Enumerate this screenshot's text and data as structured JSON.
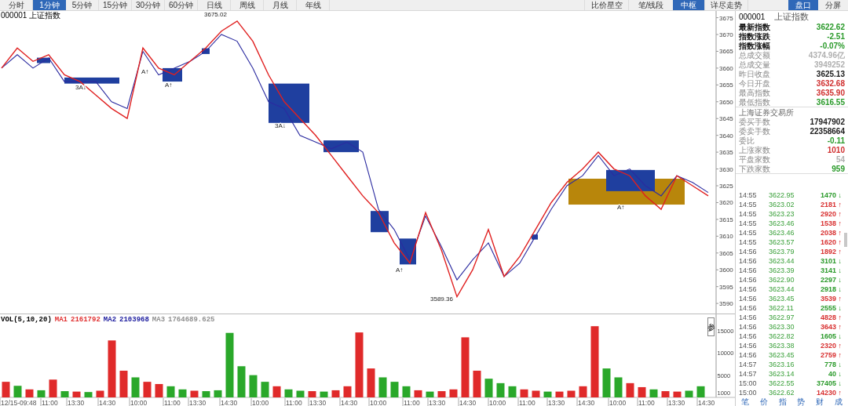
{
  "toolbar": {
    "periods": [
      {
        "label": "分时",
        "selected": false
      },
      {
        "label": "1分钟",
        "selected": true
      },
      {
        "label": "5分钟",
        "selected": false
      },
      {
        "label": "15分钟",
        "selected": false
      },
      {
        "label": "30分钟",
        "selected": false
      },
      {
        "label": "60分钟",
        "selected": false
      },
      {
        "label": "日线",
        "selected": false
      },
      {
        "label": "周线",
        "selected": false
      },
      {
        "label": "月线",
        "selected": false
      },
      {
        "label": "年线",
        "selected": false
      }
    ],
    "tools": [
      {
        "label": "比价星空",
        "selected": false
      },
      {
        "label": "笔/线段",
        "selected": false
      },
      {
        "label": "中枢",
        "selected": true
      },
      {
        "label": "详尽走势",
        "selected": false
      }
    ],
    "views": [
      {
        "label": "盘口",
        "selected": true
      },
      {
        "label": "分屏",
        "selected": false
      }
    ]
  },
  "price_chart": {
    "title": "000001 上证指数",
    "zones": [
      {
        "color": "#b8860b"
      },
      {
        "color": "#1f3f9f"
      },
      {
        "color": "#1f3f9f"
      },
      {
        "color": "#1f3f9f"
      },
      {
        "color": "#1f3f9f"
      },
      {
        "color": "#1f3f9f"
      },
      {
        "color": "#1f3f9f"
      },
      {
        "color": "#1f3f9f"
      },
      {
        "color": "#1f3f9f"
      },
      {
        "color": "#1f3f9f"
      },
      {
        "color": "#1f3f9f"
      }
    ],
    "chart_data": {
      "type": "line",
      "ylim": [
        3587,
        3677
      ],
      "yticks": [
        3590,
        3595,
        3600,
        3605,
        3610,
        3615,
        3620,
        3625,
        3630,
        3635,
        3640,
        3645,
        3650,
        3655,
        3660,
        3665,
        3670,
        3675
      ],
      "series": [
        {
          "color": "#2b2ba0",
          "values": [
            3660,
            3664,
            3660,
            3663,
            3656,
            3656,
            3656,
            3650,
            3648,
            3665,
            3658,
            3660,
            3662,
            3665,
            3670,
            3668,
            3660,
            3650,
            3648,
            3640,
            3638,
            3636,
            3638,
            3635,
            3618,
            3612,
            3603,
            3616,
            3607,
            3597,
            3603,
            3608,
            3598,
            3602,
            3610,
            3618,
            3625,
            3628,
            3634,
            3628,
            3630,
            3625,
            3622,
            3628,
            3626,
            3623
          ]
        },
        {
          "color": "#e02020",
          "values": [
            3660,
            3666,
            3662,
            3664,
            3658,
            3656,
            3652,
            3648,
            3645,
            3666,
            3660,
            3658,
            3662,
            3666,
            3671,
            3674,
            3668,
            3658,
            3650,
            3645,
            3640,
            3634,
            3628,
            3622,
            3617,
            3608,
            3602,
            3617,
            3606,
            3592,
            3600,
            3612,
            3598,
            3604,
            3612,
            3620,
            3626,
            3630,
            3635,
            3630,
            3628,
            3622,
            3618,
            3628,
            3625,
            3622
          ]
        }
      ],
      "annotations": [
        "3675.02",
        "3589.36",
        "3A↓",
        "A↑",
        "A↑",
        "3A↓",
        "A↑",
        "A↑"
      ]
    }
  },
  "volume_chart": {
    "legend": [
      {
        "text": "VOL(5,10,20)",
        "color": "#000000"
      },
      {
        "text": "MA1",
        "color": "#e03030"
      },
      {
        "text": "2161792",
        "color": "#e03030"
      },
      {
        "text": "MA2",
        "color": "#2020a0"
      },
      {
        "text": "2103968",
        "color": "#2020a0"
      },
      {
        "text": "MA3",
        "color": "#909090"
      },
      {
        "text": "1764689.625",
        "color": "#909090"
      }
    ],
    "param_label": "参",
    "chart_data": {
      "type": "bar",
      "stacked": true,
      "ylim": [
        0,
        18500
      ],
      "yticks": [
        1000,
        5000,
        10000,
        15000
      ],
      "series": [
        {
          "color": "#e02a2a",
          "values": [
            3500,
            0,
            1800,
            0,
            4000,
            0,
            1300,
            0,
            1500,
            12800,
            6000,
            0,
            3500,
            3000,
            0,
            0,
            1500,
            0,
            0,
            0,
            0,
            0,
            0,
            2500,
            0,
            0,
            1400,
            0,
            1600,
            2500,
            14600,
            6500,
            0,
            0,
            0,
            1600,
            0,
            1400,
            1800,
            13500,
            6000,
            0,
            0,
            0,
            1800,
            1500,
            0,
            1300,
            1500,
            2500,
            16000,
            0,
            0,
            3200,
            2300,
            0,
            1400,
            1300,
            0,
            0
          ]
        },
        {
          "color": "#2aa82a",
          "values": [
            0,
            2600,
            0,
            1600,
            0,
            1400,
            0,
            1200,
            0,
            0,
            0,
            4500,
            0,
            0,
            2500,
            1800,
            0,
            1400,
            1600,
            14500,
            7000,
            5000,
            3500,
            0,
            1800,
            1500,
            0,
            1300,
            0,
            0,
            0,
            0,
            4500,
            3500,
            2500,
            0,
            1300,
            0,
            0,
            0,
            0,
            4200,
            3200,
            2500,
            0,
            0,
            1300,
            0,
            0,
            0,
            0,
            6500,
            4500,
            0,
            0,
            1800,
            0,
            0,
            1500,
            2500
          ]
        }
      ]
    }
  },
  "time_axis": [
    "12/15-09:48",
    "11:00",
    "13:30",
    "14:30",
    "10:00",
    "11:00",
    "13:30",
    "14:30",
    "10:00",
    "11:00",
    "13:30",
    "14:30",
    "10:00",
    "11:00",
    "13:30",
    "14:30",
    "10:00",
    "11:00",
    "13:30",
    "14:30",
    "10:00",
    "11:00",
    "13:30",
    "14:30"
  ],
  "quote": {
    "code": "000001",
    "name": "上证指数",
    "rows": [
      {
        "label": "最新指数",
        "value": "3622.62",
        "color": "#2a9a2a",
        "strong": true
      },
      {
        "label": "指数涨跌",
        "value": "-2.51",
        "color": "#2a9a2a",
        "strong": true
      },
      {
        "label": "指数涨幅",
        "value": "-0.07%",
        "color": "#2a9a2a",
        "strong": true
      },
      {
        "label": "总成交额",
        "value": "4374.96亿",
        "color": "#b0b0b0",
        "strong": false
      },
      {
        "label": "总成交量",
        "value": "3949252",
        "color": "#b0b0b0",
        "strong": false
      },
      {
        "label": "昨日收盘",
        "value": "3625.13",
        "color": "#202020",
        "strong": false
      },
      {
        "label": "今日开盘",
        "value": "3632.68",
        "color": "#d03030",
        "strong": false
      },
      {
        "label": "最高指数",
        "value": "3635.90",
        "color": "#d03030",
        "strong": false
      },
      {
        "label": "最低指数",
        "value": "3616.55",
        "color": "#2a9a2a",
        "strong": false
      }
    ],
    "exchange": "上海证券交易所",
    "exchange_rows": [
      {
        "label": "委买手数",
        "value": "17947902",
        "color": "#202020"
      },
      {
        "label": "委卖手数",
        "value": "22358664",
        "color": "#202020"
      },
      {
        "label": "委比",
        "value": "-0.11",
        "color": "#2a9a2a"
      },
      {
        "label": "上涨家数",
        "value": "1010",
        "color": "#d03030"
      },
      {
        "label": "平盘家数",
        "value": "54",
        "color": "#b0b0b0"
      },
      {
        "label": "下跌家数",
        "value": "959",
        "color": "#2a9a2a"
      }
    ]
  },
  "trades": [
    {
      "time": "14:55",
      "price": "3622.95",
      "volume": "1470",
      "arrow": "↓",
      "color": "#2a9a2a"
    },
    {
      "time": "14:55",
      "price": "3623.02",
      "volume": "2181",
      "arrow": "↑",
      "color": "#d83030"
    },
    {
      "time": "14:55",
      "price": "3623.23",
      "volume": "2920",
      "arrow": "↑",
      "color": "#d83030"
    },
    {
      "time": "14:55",
      "price": "3623.46",
      "volume": "1538",
      "arrow": "↑",
      "color": "#d83030"
    },
    {
      "time": "14:55",
      "price": "3623.46",
      "volume": "2038",
      "arrow": "↑",
      "color": "#d83030"
    },
    {
      "time": "14:55",
      "price": "3623.57",
      "volume": "1620",
      "arrow": "↑",
      "color": "#d83030"
    },
    {
      "time": "14:56",
      "price": "3623.79",
      "volume": "1892",
      "arrow": "↑",
      "color": "#d83030"
    },
    {
      "time": "14:56",
      "price": "3623.44",
      "volume": "3101",
      "arrow": "↓",
      "color": "#2a9a2a"
    },
    {
      "time": "14:56",
      "price": "3623.39",
      "volume": "3141",
      "arrow": "↓",
      "color": "#2a9a2a"
    },
    {
      "time": "14:56",
      "price": "3622.90",
      "volume": "2297",
      "arrow": "↓",
      "color": "#2a9a2a"
    },
    {
      "time": "14:56",
      "price": "3623.44",
      "volume": "2918",
      "arrow": "↓",
      "color": "#2a9a2a"
    },
    {
      "time": "14:56",
      "price": "3623.45",
      "volume": "3539",
      "arrow": "↑",
      "color": "#d83030"
    },
    {
      "time": "14:56",
      "price": "3622.11",
      "volume": "2555",
      "arrow": "↓",
      "color": "#2a9a2a"
    },
    {
      "time": "14:56",
      "price": "3622.97",
      "volume": "4828",
      "arrow": "↑",
      "color": "#d83030"
    },
    {
      "time": "14:56",
      "price": "3623.30",
      "volume": "3643",
      "arrow": "↑",
      "color": "#d83030"
    },
    {
      "time": "14:56",
      "price": "3622.82",
      "volume": "1605",
      "arrow": "↓",
      "color": "#2a9a2a"
    },
    {
      "time": "14:56",
      "price": "3623.38",
      "volume": "2320",
      "arrow": "↑",
      "color": "#d83030"
    },
    {
      "time": "14:56",
      "price": "3623.45",
      "volume": "2759",
      "arrow": "↑",
      "color": "#d83030"
    },
    {
      "time": "14:57",
      "price": "3623.16",
      "volume": "778",
      "arrow": "↓",
      "color": "#2a9a2a"
    },
    {
      "time": "14:57",
      "price": "3623.14",
      "volume": "40",
      "arrow": "↓",
      "color": "#2a9a2a"
    },
    {
      "time": "15:00",
      "price": "3622.55",
      "volume": "37405",
      "arrow": "↓",
      "color": "#2a9a2a"
    },
    {
      "time": "15:00",
      "price": "3622.62",
      "volume": "14230",
      "arrow": "↑",
      "color": "#d83030"
    }
  ],
  "bottom_tabs": [
    "笔",
    "价",
    "指",
    "势",
    "财",
    "成"
  ]
}
